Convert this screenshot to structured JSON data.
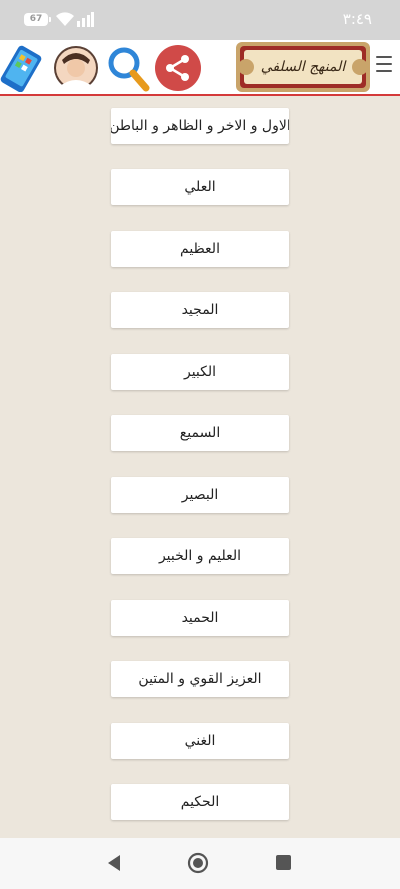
{
  "status": {
    "battery": "67",
    "time": "٣:٤٩"
  },
  "app": {
    "logo_text": "المنهج السلفي"
  },
  "menu": {
    "items": [
      "الاول و الاخر و الظاهر و الباطن",
      "العلي",
      "العظيم",
      "المجيد",
      "الكبير",
      "السميع",
      "البصير",
      "العليم و الخبير",
      "الحميد",
      "العزيز القوي و المتين",
      "الغني",
      "الحكيم"
    ]
  },
  "colors": {
    "accent": "#d43a3a",
    "share": "#d04a48",
    "search": "#2f86d8",
    "background": "#ece6dc"
  },
  "icons": [
    "hamburger-icon",
    "share-icon",
    "search-icon",
    "avatar",
    "phone-app-icon",
    "back-icon",
    "home-icon",
    "recent-apps-icon"
  ]
}
